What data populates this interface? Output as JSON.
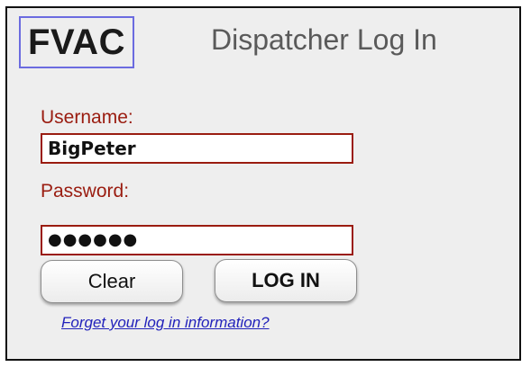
{
  "header": {
    "logo_text": "FVAC",
    "title": "Dispatcher Log In"
  },
  "form": {
    "username": {
      "label": "Username:",
      "value": "BigPeter"
    },
    "password": {
      "label": "Password:",
      "value": "●●●●●●"
    },
    "clear_label": "Clear",
    "login_label": "LOG IN",
    "forgot_link": "Forget your log in information?"
  },
  "colors": {
    "label": "#9a1c10",
    "input_border": "#9a1c10",
    "logo_border": "#6b6be0",
    "link": "#2222bb",
    "panel_bg": "#eeeeee"
  }
}
